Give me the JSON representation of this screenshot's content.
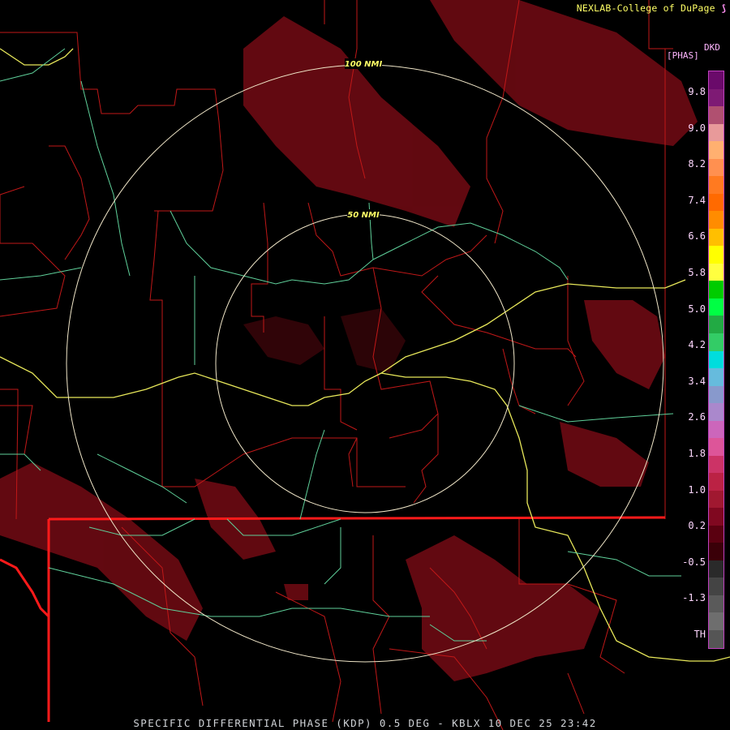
{
  "header": {
    "credit": "NEXLAB-College of DuPage",
    "logo_icon": "cod-logo-icon"
  },
  "product": {
    "title": "SPECIFIC DIFFERENTIAL PHASE (KDP) 0.5 DEG - KBLX 10 DEC 25 23:42"
  },
  "range_rings": [
    {
      "label": "100 NMI"
    },
    {
      "label": "50 NMI"
    }
  ],
  "legend": {
    "units_code": "DKD",
    "units_name": "[PHAS]",
    "ticks": [
      "9.8",
      "9.0",
      "8.2",
      "7.4",
      "6.6",
      "5.8",
      "5.0",
      "4.2",
      "3.4",
      "2.6",
      "1.8",
      "1.0",
      "0.2",
      "-0.5",
      "-1.3",
      "TH"
    ],
    "colors": [
      "#6a0a6a",
      "#7e1a74",
      "#b05070",
      "#e89a9a",
      "#ffb070",
      "#ff9050",
      "#ff7a20",
      "#ff6a00",
      "#ff8c00",
      "#ffbf00",
      "#ffff00",
      "#ffff40",
      "#00cc00",
      "#00ff44",
      "#22aa44",
      "#33cc66",
      "#00dddd",
      "#66bbdd",
      "#8899cc",
      "#aa88cc",
      "#cc66bb",
      "#dd5599",
      "#cc3366",
      "#bb2244",
      "#a01830",
      "#800820",
      "#5a0010",
      "#3a0008",
      "#2a2a2a",
      "#444444",
      "#5a5a5a",
      "#6e6e6e",
      "#555555"
    ],
    "colors_labeled": {
      "accent": "#ffff66"
    }
  }
}
